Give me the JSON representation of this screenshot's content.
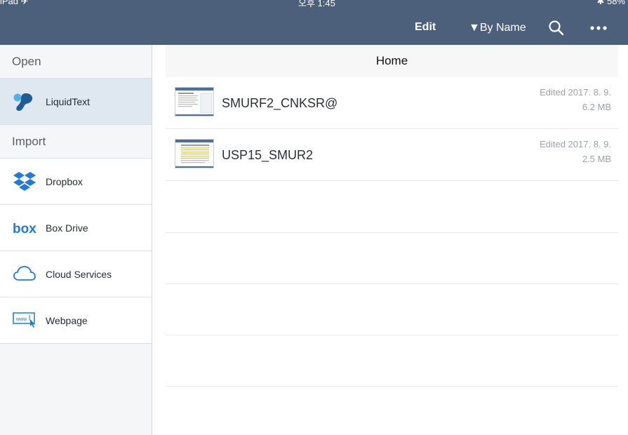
{
  "status": {
    "left": "iPad ✈",
    "center": "오후 1:45",
    "right": "✱ 58%"
  },
  "toolbar": {
    "edit_label": "Edit",
    "sort_label": "▼By Name"
  },
  "sidebar": {
    "open_header": "Open",
    "open_items": [
      {
        "label": "LiquidText",
        "icon": "liquidtext-icon"
      }
    ],
    "import_header": "Import",
    "import_items": [
      {
        "label": "Dropbox",
        "icon": "dropbox-icon"
      },
      {
        "label": "Box Drive",
        "icon": "box-icon"
      },
      {
        "label": "Cloud Services",
        "icon": "cloud-icon"
      },
      {
        "label": "Webpage",
        "icon": "webpage-icon"
      }
    ]
  },
  "main": {
    "title": "Home",
    "files": [
      {
        "name": "SMURF2_CNKSR@",
        "edited": "Edited 2017. 8. 9.",
        "size": "6.2 MB"
      },
      {
        "name": "USP15_SMUR2",
        "edited": "Edited 2017. 8. 9.",
        "size": "2.5 MB"
      }
    ]
  },
  "colors": {
    "toolbar_bg": "#4c5f7b",
    "accent_blue": "#1f7ad8",
    "active_row": "#dfe7f1"
  }
}
